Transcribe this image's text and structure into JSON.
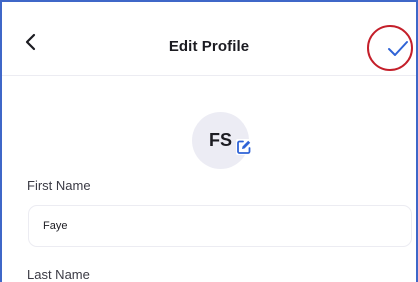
{
  "header": {
    "back_icon": "chevron-left-icon",
    "title": "Edit Profile",
    "save_icon": "checkmark-icon"
  },
  "avatar": {
    "initials": "FS",
    "edit_icon": "edit-pencil-icon"
  },
  "form": {
    "first_name": {
      "label": "First Name",
      "value": "Faye"
    },
    "last_name": {
      "label": "Last Name"
    }
  },
  "colors": {
    "accent": "#2f63d6",
    "highlight": "#c41f2a",
    "frame_border": "#3f67c8"
  }
}
